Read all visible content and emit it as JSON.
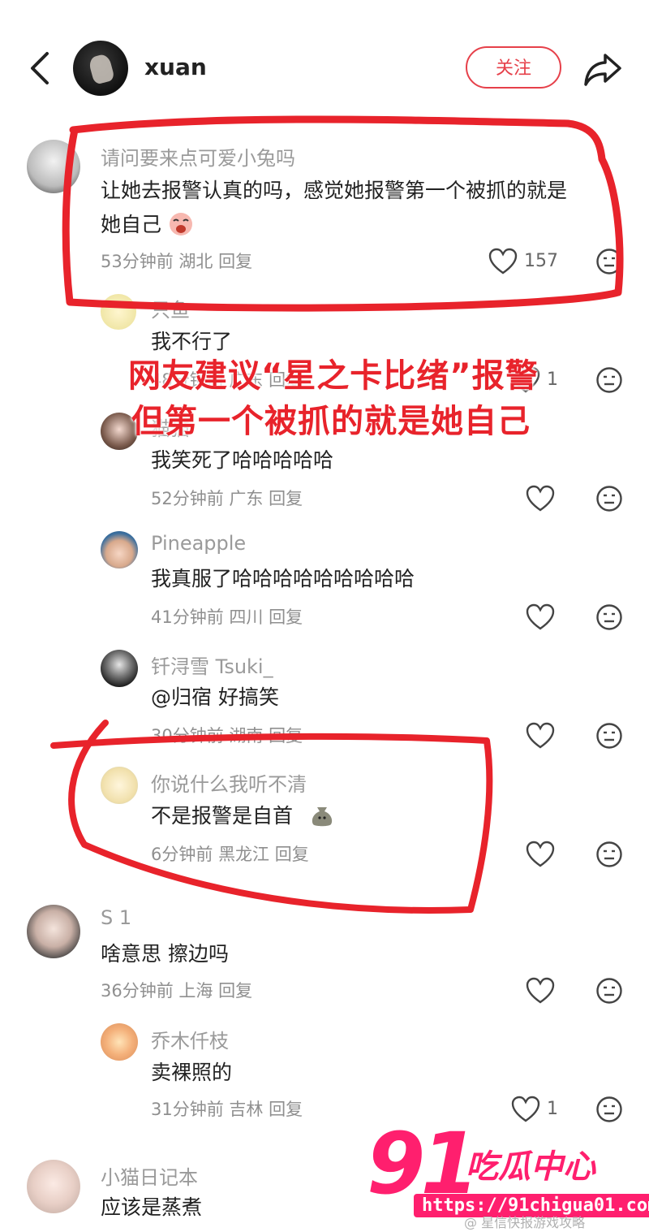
{
  "header": {
    "username": "xuan",
    "follow_label": "关注",
    "back_icon": "chevron-left-icon",
    "share_icon": "share-arrow-icon"
  },
  "comments": [
    {
      "name": "请问要来点可爱小兔吗",
      "text1": "让她去报警认真的吗，感觉她报警第一个被抓的就是",
      "text2": "她自己",
      "time": "53分钟前",
      "region": "湖北",
      "reply": "回复",
      "likes": "157"
    },
    {
      "name": "只鱼",
      "text1": "我不行了",
      "time": "48分钟前",
      "region": "广东",
      "reply": "回复",
      "likes": "1"
    },
    {
      "name": "猫猫",
      "text1": "我笑死了哈哈哈哈哈",
      "time": "52分钟前",
      "region": "广东",
      "reply": "回复"
    },
    {
      "name": "Pineapple",
      "text1": "我真服了哈哈哈哈哈哈哈哈哈",
      "time": "41分钟前",
      "region": "四川",
      "reply": "回复"
    },
    {
      "name": "钎浔雪 Tsuki_",
      "text1": "@归宿 好搞笑",
      "time": "30分钟前",
      "region": "湖南",
      "reply": "回复"
    },
    {
      "name": "你说什么我听不清",
      "text1": "不是报警是自首",
      "time": "6分钟前",
      "region": "黑龙江",
      "reply": "回复"
    },
    {
      "name": "S 1",
      "text1": "啥意思 擦边吗",
      "time": "36分钟前",
      "region": "上海",
      "reply": "回复"
    },
    {
      "name": "乔木仟枝",
      "text1": "卖裸照的",
      "time": "31分钟前",
      "region": "吉林",
      "reply": "回复",
      "likes": "1"
    },
    {
      "name": "小猫日记本",
      "text1": "应该是蒸煮"
    }
  ],
  "caption": {
    "line1": "网友建议“星之卡比绪”报警",
    "line2": "但第一个被抓的就是她自己"
  },
  "brand": {
    "number": "91",
    "name": "吃瓜中心",
    "url": "https://91chigua01.com",
    "bottom_watermark": "@ 星信快报游戏攻略"
  },
  "colors": {
    "accent": "#e6404a",
    "annotation_red": "#e8232b",
    "brand_pink": "#ff1f6e"
  }
}
